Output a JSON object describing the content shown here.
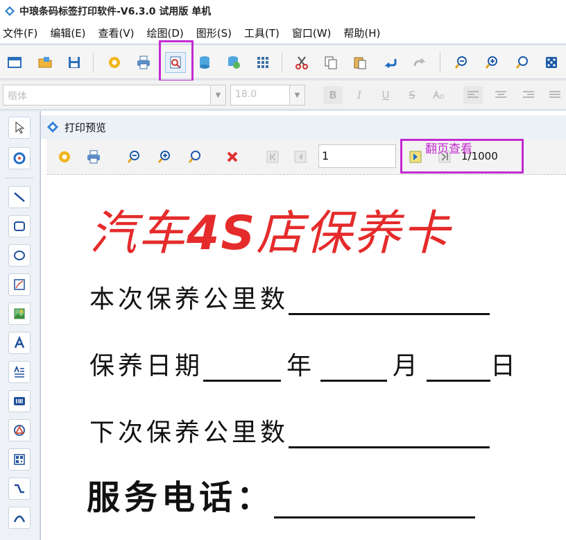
{
  "window": {
    "title": "中琅条码标签打印软件-V6.3.0 试用版 单机"
  },
  "menu": [
    "文件(F)",
    "编辑(E)",
    "查看(V)",
    "绘图(D)",
    "图形(S)",
    "工具(T)",
    "窗口(W)",
    "帮助(H)"
  ],
  "fontbar": {
    "font_name": "楷体",
    "font_size": "18.0"
  },
  "format_buttons": [
    "B",
    "I",
    "U",
    "S"
  ],
  "preview": {
    "title": "打印预览",
    "page_input": "1",
    "page_count": "1/1000",
    "hint": "翻页查看"
  },
  "card": {
    "title_a": "汽车",
    "title_b": "4S",
    "title_c": "店保养卡",
    "field1": "本次保养公里数",
    "field2_label": "保养日期",
    "field2_year": "年",
    "field2_month": "月",
    "field2_day": "日",
    "field3": "下次保养公里数",
    "phone": "服务电话："
  },
  "colors": {
    "highlight": "#c32ad0",
    "title_red": "#e52b2b"
  }
}
